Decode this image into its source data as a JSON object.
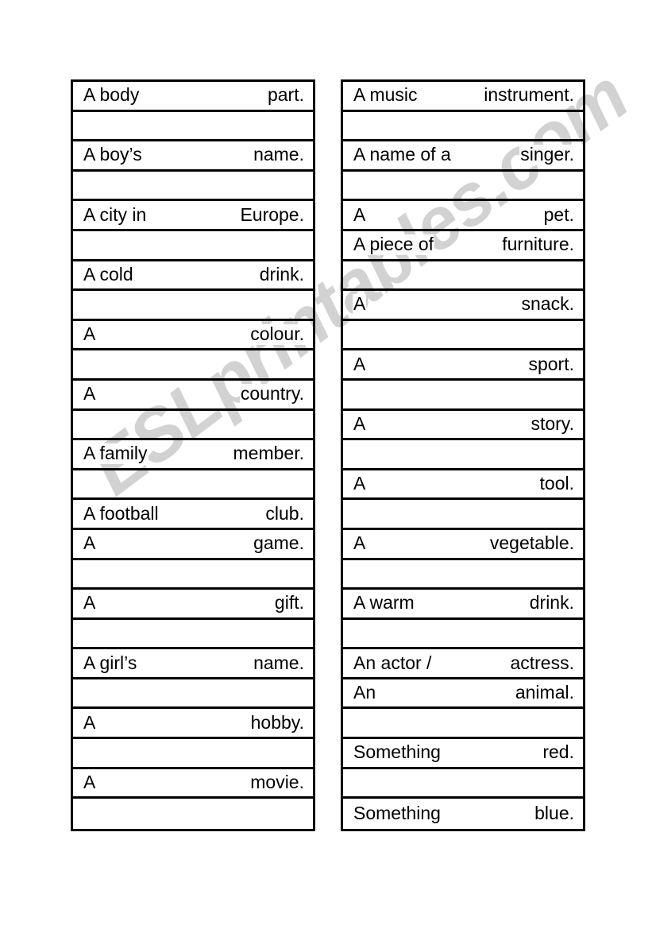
{
  "document": {
    "type": "worksheet",
    "watermark": "ESLprintables.com",
    "watermark_color": "#d2d2d2",
    "border_color": "#000000",
    "background_color": "#ffffff"
  },
  "left_column": {
    "name": "left-prompt-table",
    "rows": [
      {
        "lead": "A body",
        "tail": "part."
      },
      {
        "lead": "",
        "tail": ""
      },
      {
        "lead": "A boy’s",
        "tail": "name."
      },
      {
        "lead": "",
        "tail": ""
      },
      {
        "lead": "A city in",
        "tail": "Europe."
      },
      {
        "lead": "",
        "tail": ""
      },
      {
        "lead": "A cold",
        "tail": "drink."
      },
      {
        "lead": "",
        "tail": ""
      },
      {
        "lead": "A",
        "tail": "colour."
      },
      {
        "lead": "",
        "tail": ""
      },
      {
        "lead": "A",
        "tail": "country."
      },
      {
        "lead": "",
        "tail": ""
      },
      {
        "lead": "A family",
        "tail": "member."
      },
      {
        "lead": "",
        "tail": ""
      },
      {
        "lead": "A football",
        "tail": "club."
      },
      {
        "lead": "A",
        "tail": "game."
      },
      {
        "lead": "",
        "tail": ""
      },
      {
        "lead": "A",
        "tail": "gift."
      },
      {
        "lead": "",
        "tail": ""
      },
      {
        "lead": "A girl’s",
        "tail": "name."
      },
      {
        "lead": "",
        "tail": ""
      },
      {
        "lead": "A",
        "tail": "hobby."
      },
      {
        "lead": "",
        "tail": ""
      },
      {
        "lead": "A",
        "tail": "movie."
      },
      {
        "lead": "",
        "tail": ""
      }
    ]
  },
  "right_column": {
    "name": "right-prompt-table",
    "rows": [
      {
        "lead": "A music",
        "tail": "instrument."
      },
      {
        "lead": "",
        "tail": ""
      },
      {
        "lead": "A name of a",
        "tail": "singer."
      },
      {
        "lead": "",
        "tail": ""
      },
      {
        "lead": "A",
        "tail": "pet."
      },
      {
        "lead": "A piece of",
        "tail": "furniture."
      },
      {
        "lead": "",
        "tail": ""
      },
      {
        "lead": "A",
        "tail": "snack."
      },
      {
        "lead": "",
        "tail": ""
      },
      {
        "lead": "A",
        "tail": "sport."
      },
      {
        "lead": "",
        "tail": ""
      },
      {
        "lead": "A",
        "tail": "story."
      },
      {
        "lead": "",
        "tail": ""
      },
      {
        "lead": "A",
        "tail": "tool."
      },
      {
        "lead": "",
        "tail": ""
      },
      {
        "lead": "A",
        "tail": "vegetable."
      },
      {
        "lead": "",
        "tail": ""
      },
      {
        "lead": "A warm",
        "tail": "drink."
      },
      {
        "lead": "",
        "tail": ""
      },
      {
        "lead": "An actor /",
        "tail": "actress."
      },
      {
        "lead": "An",
        "tail": "animal."
      },
      {
        "lead": "",
        "tail": ""
      },
      {
        "lead": "Something",
        "tail": "red."
      },
      {
        "lead": "",
        "tail": ""
      },
      {
        "lead": "Something",
        "tail": "blue."
      }
    ]
  }
}
